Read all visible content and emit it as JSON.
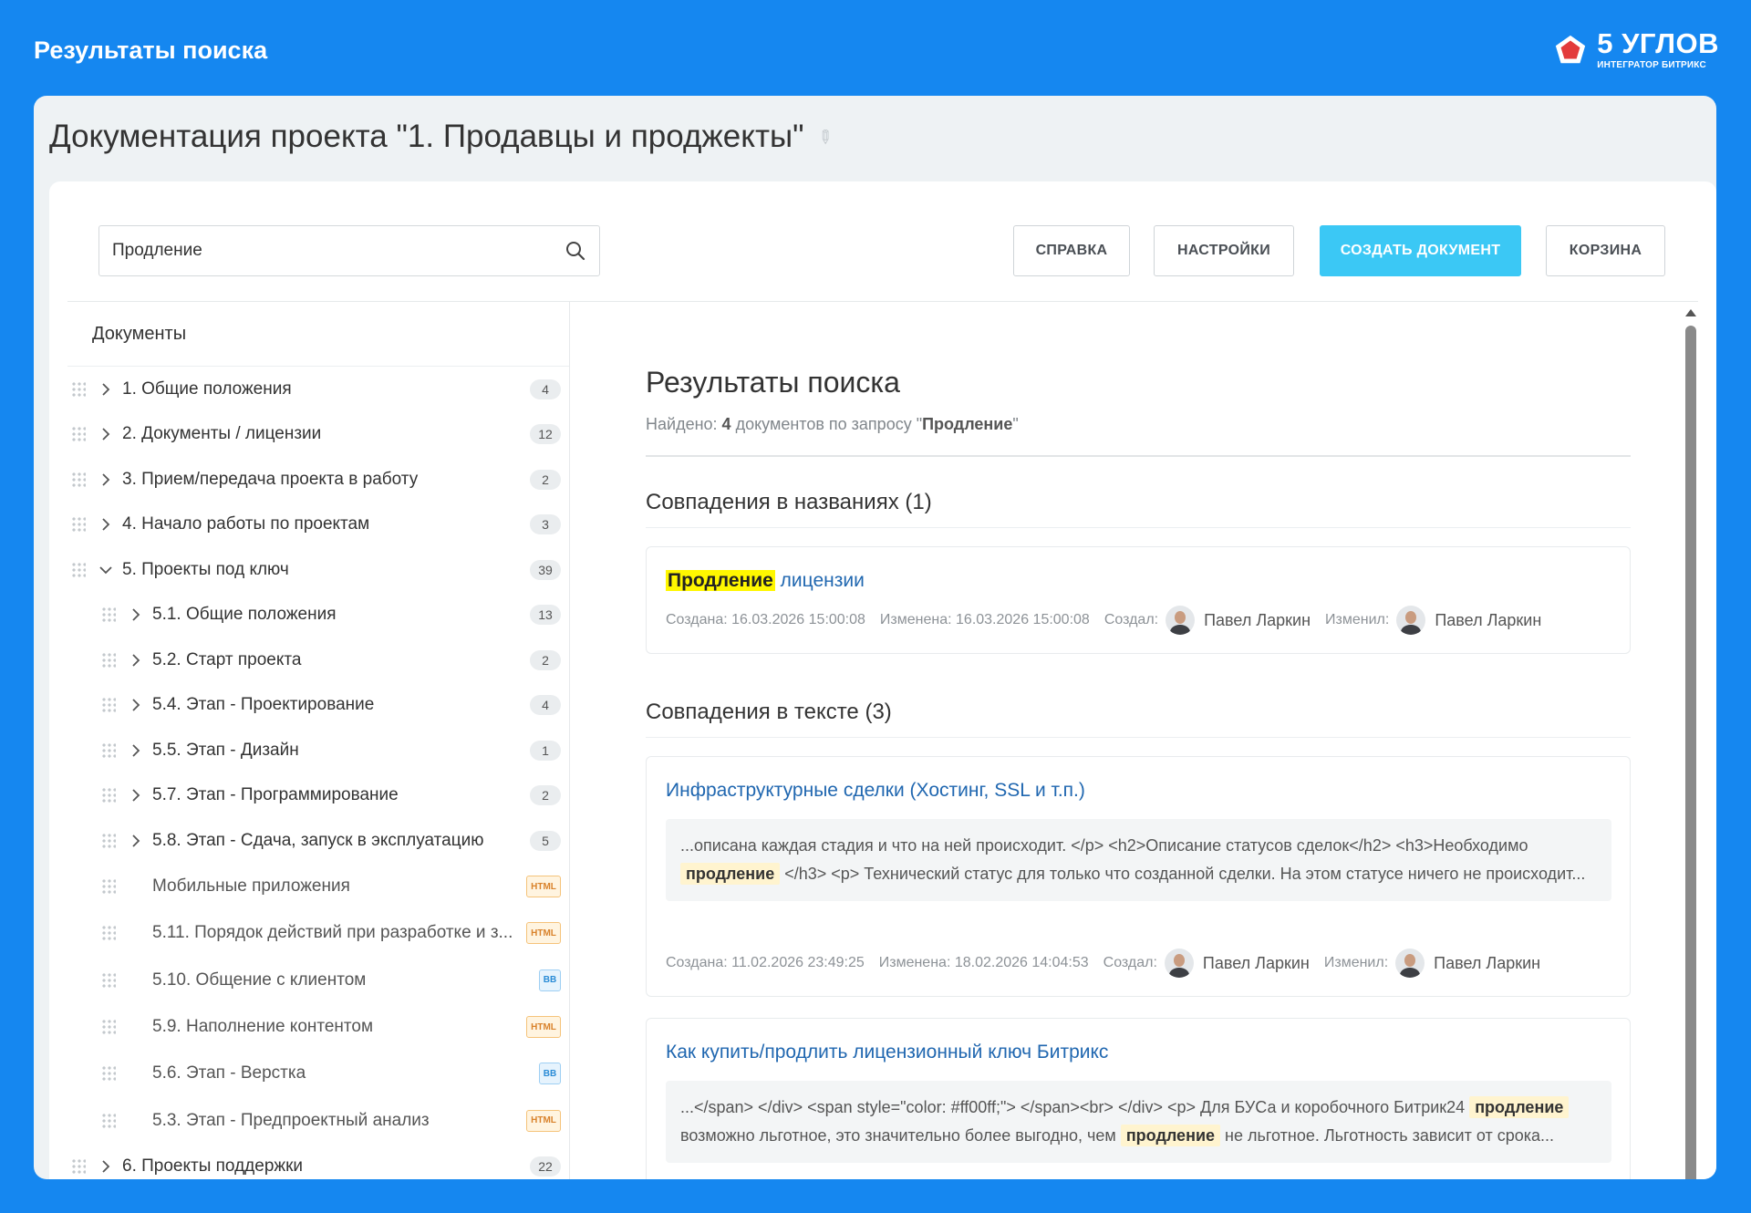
{
  "banner": {
    "title": "Результаты поиска",
    "logo_main": "5 УГЛОВ",
    "logo_sub": "ИНТЕГРАТОР БИТРИКС"
  },
  "page": {
    "title": "Документация проекта \"1. Продавцы и проджекты\"",
    "pin_icon": "pin-icon"
  },
  "toolbar": {
    "search_value": "Продление",
    "help": "СПРАВКА",
    "settings": "НАСТРОЙКИ",
    "create": "СОЗДАТЬ ДОКУМЕНТ",
    "trash": "КОРЗИНА"
  },
  "sidebar": {
    "heading": "Документы",
    "items": [
      {
        "label": "1. Общие положения",
        "count": "4",
        "level": 0,
        "state": "collapsed"
      },
      {
        "label": "2. Документы / лицензии",
        "count": "12",
        "level": 0,
        "state": "collapsed"
      },
      {
        "label": "3. Прием/передача проекта в работу",
        "count": "2",
        "level": 0,
        "state": "collapsed"
      },
      {
        "label": "4. Начало работы по проектам",
        "count": "3",
        "level": 0,
        "state": "collapsed"
      },
      {
        "label": "5. Проекты под ключ",
        "count": "39",
        "level": 0,
        "state": "expanded"
      },
      {
        "label": "5.1. Общие положения",
        "count": "13",
        "level": 1,
        "state": "collapsed"
      },
      {
        "label": "5.2. Старт проекта",
        "count": "2",
        "level": 1,
        "state": "collapsed"
      },
      {
        "label": "5.4. Этап - Проектирование",
        "count": "4",
        "level": 1,
        "state": "collapsed"
      },
      {
        "label": "5.5. Этап - Дизайн",
        "count": "1",
        "level": 1,
        "state": "collapsed"
      },
      {
        "label": "5.7. Этап - Программирование",
        "count": "2",
        "level": 1,
        "state": "collapsed"
      },
      {
        "label": "5.8. Этап - Сдача, запуск в эксплуатацию",
        "count": "5",
        "level": 1,
        "state": "collapsed"
      },
      {
        "label": "Мобильные приложения",
        "badge": "HTML",
        "level": 1,
        "state": "leaf"
      },
      {
        "label": "5.11. Порядок действий при разработке и з...",
        "badge": "HTML",
        "level": 1,
        "state": "leaf"
      },
      {
        "label": "5.10. Общение с клиентом",
        "badge": "BB",
        "level": 1,
        "state": "leaf"
      },
      {
        "label": "5.9. Наполнение контентом",
        "badge": "HTML",
        "level": 1,
        "state": "leaf"
      },
      {
        "label": "5.6. Этап - Верстка",
        "badge": "BB",
        "level": 1,
        "state": "leaf"
      },
      {
        "label": "5.3. Этап - Предпроектный анализ",
        "badge": "HTML",
        "level": 1,
        "state": "leaf"
      },
      {
        "label": "6. Проекты поддержки",
        "count": "22",
        "level": 0,
        "state": "collapsed"
      }
    ]
  },
  "results": {
    "title": "Результаты поиска",
    "found_prefix": "Найдено:",
    "found_count": "4",
    "found_middle": "документов по запросу \"",
    "found_query": "Продление",
    "found_suffix": "\"",
    "title_matches_heading": "Совпадения в названиях (1)",
    "text_matches_heading": "Совпадения в тексте (3)",
    "meta_labels": {
      "author": "Создал:",
      "editor": "Изменил:"
    },
    "title_matches": [
      {
        "title_highlight": "Продление",
        "title_rest": " лицензии",
        "created": "Создана: 16.03.2026 15:00:08",
        "modified": "Изменена: 16.03.2026 15:00:08",
        "author": "Павел Ларкин",
        "editor": "Павел Ларкин"
      }
    ],
    "text_matches": [
      {
        "title": "Инфраструктурные сделки (Хостинг, SSL и т.п.)",
        "snippet_1": "...описана каждая стадия и что на ней происходит. </p> <h2>Описание статусов сделок</h2> <h3>Необходимо ",
        "hl_1": "продление",
        "snippet_2": " </h3> <p> Технический статус для только что созданной сделки. На этом статусе ничего не происходит...",
        "created": "Создана: 11.02.2026 23:49:25",
        "modified": "Изменена: 18.02.2026 14:04:53",
        "author": "Павел Ларкин",
        "editor": "Павел Ларкин"
      },
      {
        "title": "Как купить/продлить лицензионный ключ Битрикс",
        "snippet_1": "...</span> </div> <span style=\"color: #ff00ff;\"> </span><br> </div> <p> Для БУСа и коробочного Битрик24 ",
        "hl_1": "продление",
        "snippet_2": " возможно льготное, это значительно более выгодно, чем ",
        "hl_2": "продление",
        "snippet_3": " не льготное. Льготность зависит от срока..."
      }
    ]
  }
}
